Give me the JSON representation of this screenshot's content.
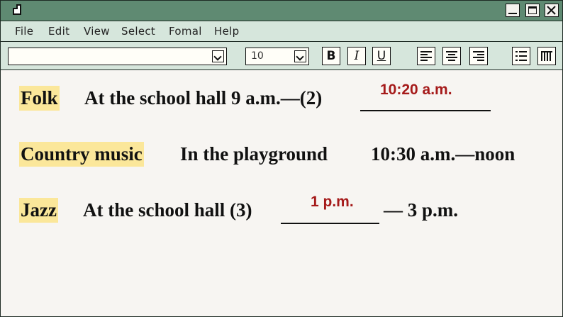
{
  "menu": {
    "items": [
      "File",
      "Edit",
      "View",
      "Select",
      "Fomal",
      "Help"
    ]
  },
  "toolbar": {
    "font_name_value": "",
    "font_size_value": "10",
    "bold_label": "B",
    "italic_label": "I",
    "underline_label": "U"
  },
  "rows": [
    {
      "category": "Folk",
      "text": "At the school hall 9 a.m.—(2)",
      "answer": "10:20 a.m.",
      "suffix": ""
    },
    {
      "category": "Country music",
      "text": "In the playground",
      "time": "10:30 a.m.—noon"
    },
    {
      "category": "Jazz",
      "text": "At the school hall (3)",
      "answer": "1 p.m.",
      "suffix": "— 3 p.m."
    }
  ],
  "colors": {
    "titlebar": "#5f8a72",
    "menubar": "#d6e6dc",
    "highlight": "#fbe79a",
    "answer": "#a51a1a"
  }
}
